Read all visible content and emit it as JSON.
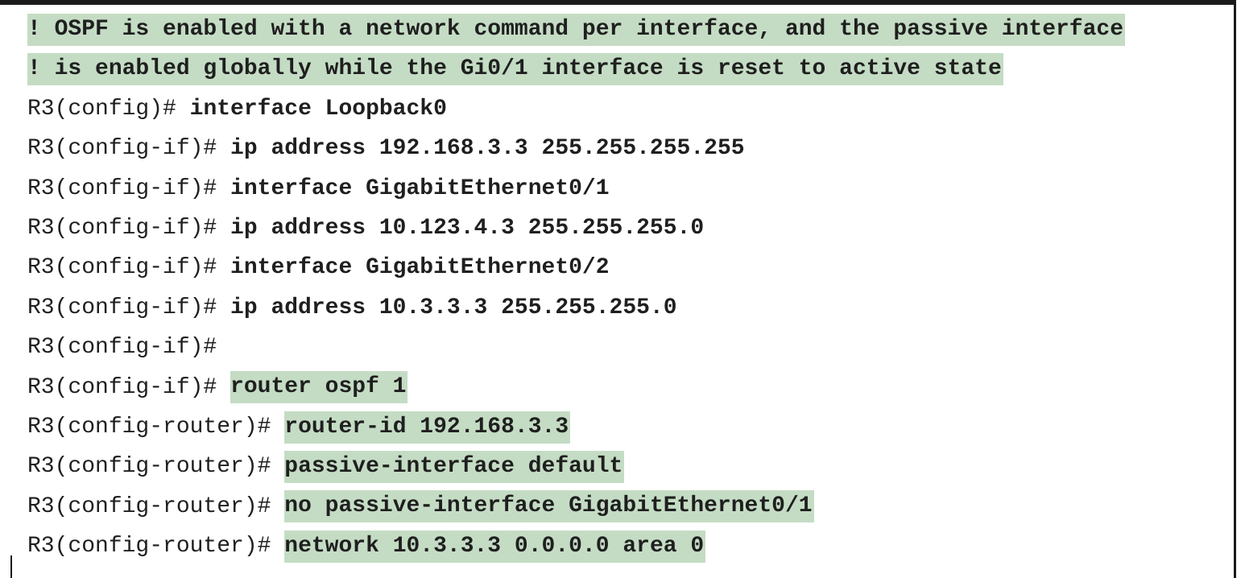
{
  "listing": {
    "lines": [
      {
        "type": "comment",
        "text": "! OSPF is enabled with a network command per interface, and the passive interface"
      },
      {
        "type": "comment",
        "text": "! is enabled globally while the Gi0/1 interface is reset to active state"
      },
      {
        "type": "config",
        "prompt": "R3(config)# ",
        "command": "interface Loopback0",
        "highlight": false
      },
      {
        "type": "config",
        "prompt": "R3(config-if)# ",
        "command": "ip address 192.168.3.3 255.255.255.255",
        "highlight": false
      },
      {
        "type": "config",
        "prompt": "R3(config-if)# ",
        "command": "interface GigabitEthernet0/1",
        "highlight": false
      },
      {
        "type": "config",
        "prompt": "R3(config-if)# ",
        "command": "ip address 10.123.4.3 255.255.255.0",
        "highlight": false
      },
      {
        "type": "config",
        "prompt": "R3(config-if)# ",
        "command": "interface GigabitEthernet0/2",
        "highlight": false
      },
      {
        "type": "config",
        "prompt": "R3(config-if)# ",
        "command": "ip address 10.3.3.3 255.255.255.0",
        "highlight": false
      },
      {
        "type": "config",
        "prompt": "R3(config-if)#",
        "command": "",
        "highlight": false
      },
      {
        "type": "config",
        "prompt": "R3(config-if)# ",
        "command": "router ospf 1",
        "highlight": true
      },
      {
        "type": "config",
        "prompt": "R3(config-router)# ",
        "command": "router-id 192.168.3.3",
        "highlight": true
      },
      {
        "type": "config",
        "prompt": "R3(config-router)# ",
        "command": "passive-interface default",
        "highlight": true
      },
      {
        "type": "config",
        "prompt": "R3(config-router)# ",
        "command": "no passive-interface GigabitEthernet0/1",
        "highlight": true
      },
      {
        "type": "config",
        "prompt": "R3(config-router)# ",
        "command": "network 10.3.3.3 0.0.0.0 area 0",
        "highlight": true
      }
    ]
  },
  "colors": {
    "highlight": "#c4dcc4",
    "text": "#1f1f1f",
    "rule": "#1a1a1a"
  }
}
